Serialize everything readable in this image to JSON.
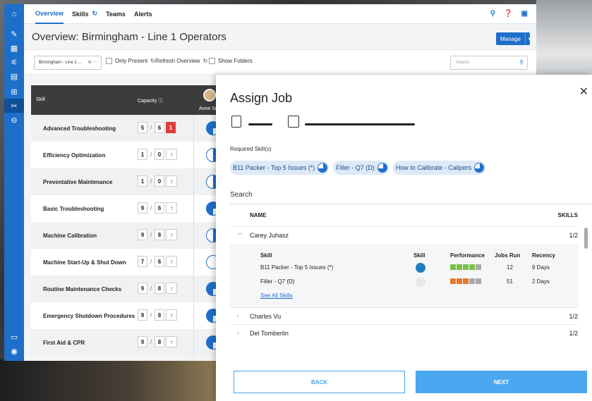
{
  "app": {
    "tabs": [
      "Overview",
      "Skills",
      "Teams",
      "Alerts"
    ],
    "page_title": "Overview: Birmingham - Line 1 Operators",
    "manage_label": "Manage",
    "filter_select": "Birmingham - Line 1 ...",
    "only_present": "Only Present",
    "refresh": "Refresh Overview",
    "show_folders": "Show Folders",
    "search_placeholder": "Search",
    "table_header_skill": "Skill",
    "table_header_capacity": "Capacity",
    "operator_name": "Anne Sn",
    "skills": [
      {
        "name": "Advanced Troubleshooting",
        "a": "5",
        "b": "6",
        "c": "1"
      },
      {
        "name": "Efficiency Optimization",
        "a": "1",
        "b": "0"
      },
      {
        "name": "Preventative Maintenance",
        "a": "1",
        "b": "0"
      },
      {
        "name": "Basic Troubleshooting",
        "a": "9",
        "b": "6"
      },
      {
        "name": "Machine Calibration",
        "a": "9",
        "b": "8"
      },
      {
        "name": "Machine Start-Up & Shut Down",
        "a": "7",
        "b": "6"
      },
      {
        "name": "Routine Maintenance Checks",
        "a": "9",
        "b": "8"
      },
      {
        "name": "Emergency Shutdown Procedures",
        "a": "9",
        "b": "8"
      },
      {
        "name": "First Aid & CPR",
        "a": "9",
        "b": "8"
      }
    ],
    "colors": {
      "primary": "#1e6fc9",
      "rail": "#1e6fc9",
      "danger": "#e03b3b"
    }
  },
  "modal": {
    "title": "Assign Job",
    "required_label": "Required Skill(s)",
    "chips": [
      "B11 Packer - Top 5 Issues (*)",
      "Filler - Q7 (D)",
      "How to Calibrate - Calipers"
    ],
    "search_label": "Search",
    "col_name": "NAME",
    "col_skills": "SKILLS",
    "people": [
      {
        "name": "Carey Juhasz",
        "count": "1/2"
      },
      {
        "name": "Charles Vu",
        "count": "1/2"
      },
      {
        "name": "Del Tomberlin",
        "count": "1/2"
      }
    ],
    "detail": {
      "h_skill": "Skill",
      "h_skill2": "Skill",
      "h_perf": "Performance",
      "h_jobs": "Jobs Run",
      "h_recency": "Recency",
      "rows": [
        {
          "skill": "B11 Packer - Top 5 Issues (*)",
          "jobs": "12",
          "recency": "9 Days"
        },
        {
          "skill": "Filler - Q7 (D)",
          "jobs": "51",
          "recency": "2 Days"
        }
      ],
      "see_all": "See All Skills"
    },
    "back": "BACK",
    "next": "NEXT"
  }
}
